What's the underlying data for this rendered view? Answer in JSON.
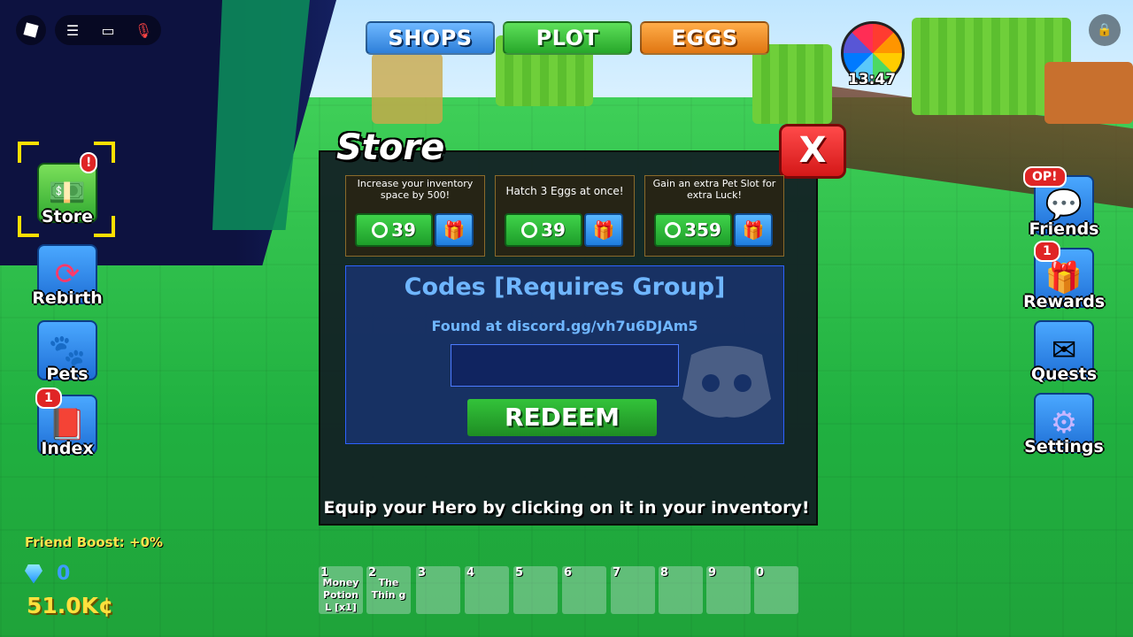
{
  "topbar": {
    "tabs": [
      {
        "label": "SHOPS"
      },
      {
        "label": "PLOT"
      },
      {
        "label": "EGGS"
      }
    ]
  },
  "wheel": {
    "timer": "13:47"
  },
  "left_menu": {
    "store": {
      "label": "Store",
      "badge": "!"
    },
    "rebirth": {
      "label": "Rebirth"
    },
    "pets": {
      "label": "Pets"
    },
    "index": {
      "label": "Index",
      "badge": "1"
    }
  },
  "right_menu": {
    "friends": {
      "label": "Friends",
      "badge": "OP!"
    },
    "rewards": {
      "label": "Rewards",
      "badge": "1"
    },
    "quests": {
      "label": "Quests"
    },
    "settings": {
      "label": "Settings"
    }
  },
  "store": {
    "title": "Store",
    "close_label": "X",
    "cards": [
      {
        "text": "Increase your inventory space by 500!",
        "price": "39"
      },
      {
        "text": "Hatch 3 Eggs at once!",
        "price": "39"
      },
      {
        "text": "Gain an extra Pet Slot for extra Luck!",
        "price": "359"
      }
    ],
    "codes": {
      "title": "Codes [Requires Group]",
      "subtitle": "Found at discord.gg/vh7u6DJAm5",
      "input_value": "",
      "redeem_label": "REDEEM"
    },
    "tip": "Equip your Hero by clicking on it in your inventory!"
  },
  "stats": {
    "friend_boost": "Friend Boost: +0%",
    "gems": "0",
    "cash": "51.0K¢"
  },
  "hotbar": [
    {
      "num": "1",
      "name": "Money Potion L [x1]"
    },
    {
      "num": "2",
      "name": "The Thin g"
    },
    {
      "num": "3",
      "name": ""
    },
    {
      "num": "4",
      "name": ""
    },
    {
      "num": "5",
      "name": ""
    },
    {
      "num": "6",
      "name": ""
    },
    {
      "num": "7",
      "name": ""
    },
    {
      "num": "8",
      "name": ""
    },
    {
      "num": "9",
      "name": ""
    },
    {
      "num": "0",
      "name": ""
    }
  ]
}
